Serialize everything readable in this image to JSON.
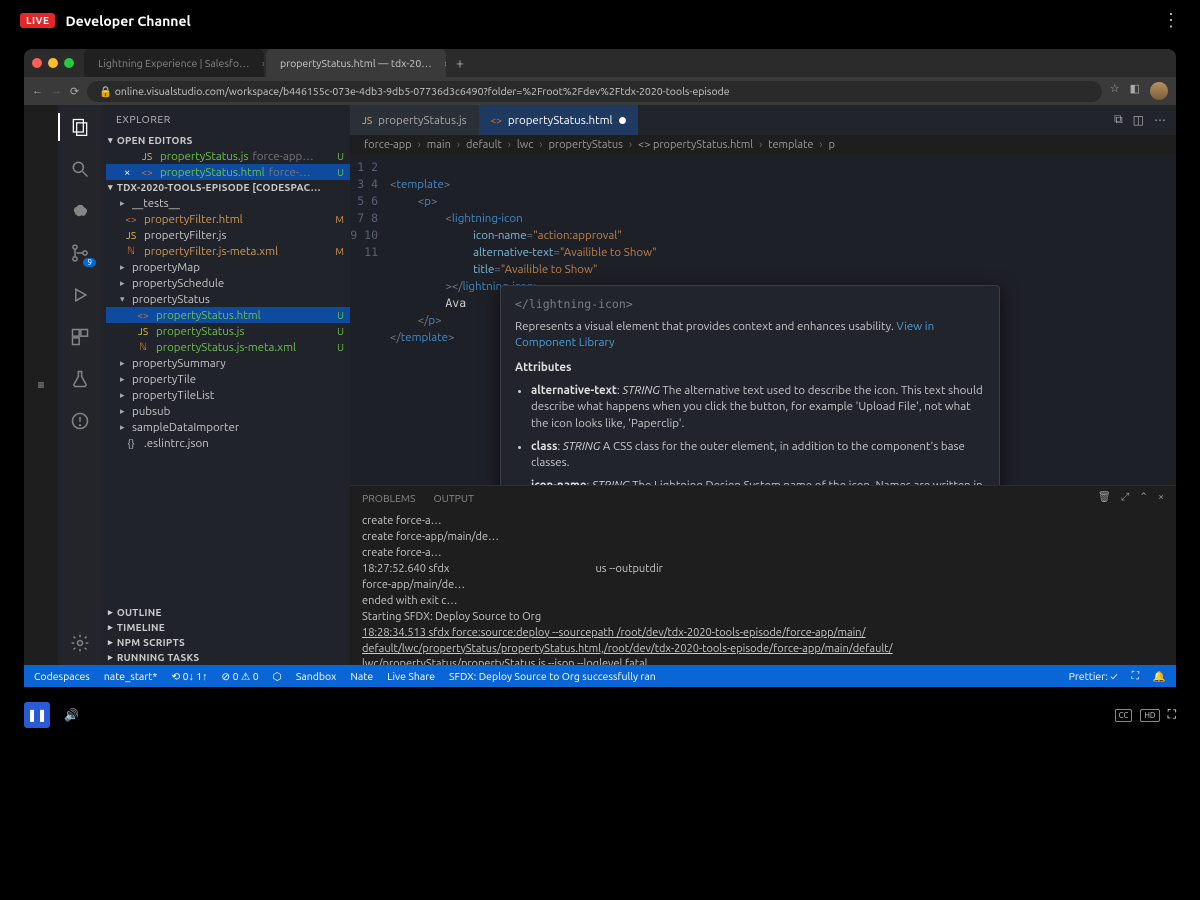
{
  "channel": {
    "live": "LIVE",
    "title": "Developer Channel"
  },
  "browser": {
    "tabs": [
      {
        "label": "Lightning Experience | Salesfo…"
      },
      {
        "label": "propertyStatus.html — tdx-20…"
      }
    ],
    "url": "online.visualstudio.com/workspace/b446155c-073e-4db3-9db5-07736d3c6490?folder=%2Froot%2Fdev%2Ftdx-2020-tools-episode"
  },
  "sidebar": {
    "title": "EXPLORER",
    "open_editors": "OPEN EDITORS",
    "workspace": "TDX-2020-TOOLS-EPISODE [CODESPAC…",
    "editors": [
      {
        "icon": "JS",
        "name": "propertyStatus.js",
        "hint": "force-app…",
        "status": "U"
      },
      {
        "icon": "<>",
        "name": "propertyStatus.html",
        "hint": "force-…",
        "status": "U",
        "close": true,
        "selected": true
      }
    ],
    "tree": [
      {
        "type": "folder",
        "name": "__tests__",
        "status": ""
      },
      {
        "type": "file",
        "icon": "<>",
        "name": "propertyFilter.html",
        "status": "M"
      },
      {
        "type": "file",
        "icon": "JS",
        "name": "propertyFilter.js",
        "status": ""
      },
      {
        "type": "file",
        "icon": "XML",
        "name": "propertyFilter.js-meta.xml",
        "status": "M"
      },
      {
        "type": "folder",
        "name": "propertyMap",
        "status": ""
      },
      {
        "type": "folder",
        "name": "propertySchedule",
        "status": ""
      },
      {
        "type": "folder",
        "name": "propertyStatus",
        "status": "",
        "open": true
      },
      {
        "type": "file",
        "icon": "<>",
        "name": "propertyStatus.html",
        "status": "U",
        "selected": true,
        "child": true
      },
      {
        "type": "file",
        "icon": "JS",
        "name": "propertyStatus.js",
        "status": "U",
        "child": true
      },
      {
        "type": "file",
        "icon": "XML",
        "name": "propertyStatus.js-meta.xml",
        "status": "U",
        "child": true
      },
      {
        "type": "folder",
        "name": "propertySummary",
        "status": ""
      },
      {
        "type": "folder",
        "name": "propertyTile",
        "status": ""
      },
      {
        "type": "folder",
        "name": "propertyTileList",
        "status": ""
      },
      {
        "type": "folder",
        "name": "pubsub",
        "status": ""
      },
      {
        "type": "folder",
        "name": "sampleDataImporter",
        "status": ""
      },
      {
        "type": "file",
        "icon": "{}",
        "name": ".eslintrc.json",
        "status": ""
      }
    ],
    "collapsed": [
      "OUTLINE",
      "TIMELINE",
      "NPM SCRIPTS",
      "RUNNING TASKS"
    ]
  },
  "editor": {
    "tabs": [
      {
        "icon": "JS",
        "label": "propertyStatus.js"
      },
      {
        "icon": "<>",
        "label": "propertyStatus.html",
        "active": true,
        "dirty": true
      }
    ],
    "breadcrumb": [
      "force-app",
      "main",
      "default",
      "lwc",
      "propertyStatus",
      "<> propertyStatus.html",
      "template",
      "p"
    ],
    "lines": [
      "1",
      "2",
      "3",
      "4",
      "5",
      "6",
      "7",
      "8",
      "9",
      "10",
      "11"
    ]
  },
  "hover": {
    "closeTag": "</lightning-icon>",
    "desc": "Represents a visual element that provides context and enhances usability.",
    "link": "View in Component Library",
    "attr_title": "Attributes",
    "attrs": [
      {
        "name": "alternative-text",
        "type": "STRING",
        "desc": "The alternative text used to describe the icon. This text should describe what happens when you click the button, for example 'Upload File', not what the icon looks like, 'Paperclip'."
      },
      {
        "name": "class",
        "type": "STRING",
        "desc": "A CSS class for the outer element, in addition to the component's base classes."
      },
      {
        "name": "icon-name",
        "type": "STRING",
        "desc": "The Lightning Design System name of the icon. Names are written in the format 'utility:down' where 'utility' is the category, and 'down' is the specific icon to be displayed."
      }
    ]
  },
  "panel": {
    "tabs": [
      "PROBLEMS",
      "OUTPUT"
    ],
    "lines": [
      "create force-a…",
      "create force-app/main/de…",
      "create force-a…",
      "",
      "18:27:52.640 sfdx                                                          us --outputdir",
      "force-app/main/de…",
      "ended with exit c…",
      "",
      "Starting SFDX: Deploy Source to Org",
      "",
      "18:28:34.513 sfdx force:source:deploy --sourcepath /root/dev/tdx-2020-tools-episode/force-app/main/",
      "default/lwc/propertyStatus/propertyStatus.html,/root/dev/tdx-2020-tools-episode/force-app/main/default/",
      "lwc/propertyStatus/propertyStatus.js --json --loglevel fatal"
    ]
  },
  "statusbar": {
    "left": [
      "Codespaces",
      "nate_start*",
      "⟲ 0↓ 1↑",
      "⊘ 0 ⚠ 0",
      "⬡",
      "Sandbox",
      "Nate",
      "Live Share",
      "SFDX: Deploy Source to Org successfully ran"
    ],
    "right": [
      "Prettier: ✓",
      "⛶",
      "🔔"
    ]
  },
  "player": {
    "cc": "CC",
    "hd": "HD"
  },
  "activity_badge": "9"
}
